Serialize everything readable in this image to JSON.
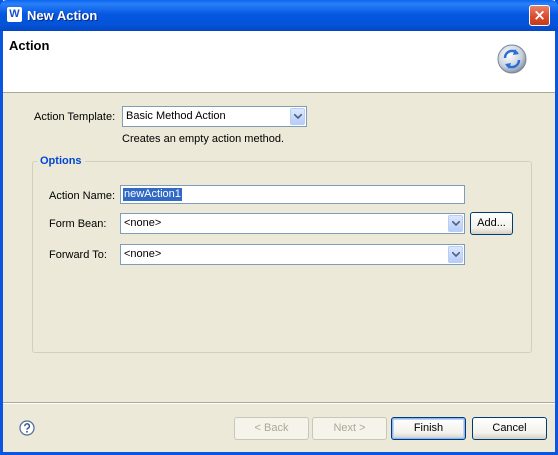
{
  "window": {
    "title": "New Action",
    "app_icon_glyph": "W",
    "close_glyph": "×"
  },
  "header": {
    "title": "Action",
    "icon": "wizard-refresh-icon"
  },
  "form": {
    "template_label": "Action Template:",
    "template_value": "Basic Method Action",
    "template_description": "Creates an empty action method.",
    "options_title": "Options",
    "action_name_label": "Action Name:",
    "action_name_value": "newAction1",
    "form_bean_label": "Form Bean:",
    "form_bean_value": "<none>",
    "add_button": "Add...",
    "forward_to_label": "Forward To:",
    "forward_to_value": "<none>"
  },
  "footer": {
    "help_icon": "help-icon",
    "back_label": "< Back",
    "next_label": "Next >",
    "finish_label": "Finish",
    "cancel_label": "Cancel"
  },
  "colors": {
    "titlebar": "#0453d8",
    "dialog_bg": "#ece9d8",
    "group_title": "#0046d5",
    "selection": "#316ac5"
  }
}
